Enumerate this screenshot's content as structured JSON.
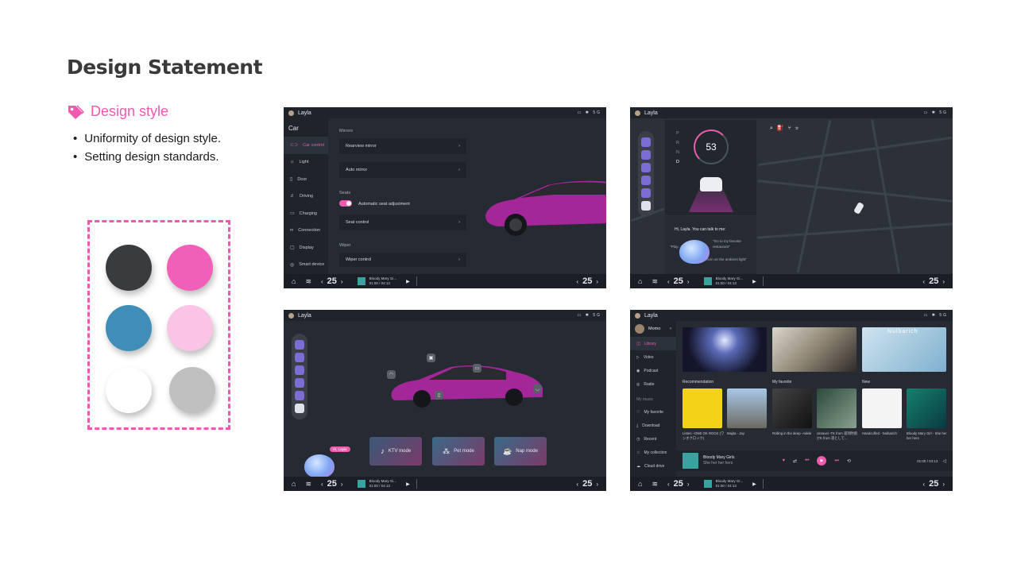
{
  "heading": "Design Statement",
  "style_section": {
    "label": "Design style",
    "bullets": [
      "Uniformity of design style.",
      "Setting design standards."
    ]
  },
  "palette": [
    "#3a3b3d",
    "#f060b8",
    "#3f8db8",
    "#fbc4e6",
    "#ffffff",
    "#c0c0c0"
  ],
  "common": {
    "user_name": "Layla",
    "status": "▭ ✱ 5G",
    "temp_left": "25",
    "temp_right": "25",
    "song_title": "Bloody Mary Gi...",
    "song_time": "01:00 / 04:13"
  },
  "screen1": {
    "sidebar_title": "Car",
    "sidebar_items": [
      "Car control",
      "Light",
      "Door",
      "Driving",
      "Charging",
      "Connection",
      "Display",
      "Smart device"
    ],
    "sections": {
      "mirrors": "Mirrors",
      "seats": "Seats",
      "wiper": "Wiper"
    },
    "rows": {
      "rearview": "Rearview mirror",
      "auto_mirror": "Auto mirror",
      "auto_seat": "Automatic seat adjustment",
      "seat_control": "Seat control",
      "wiper_control": "Wiper control"
    }
  },
  "screen2": {
    "speed": "53",
    "gears": [
      "P",
      "R",
      "N",
      "D"
    ],
    "greeting": "Hi, Layla. You can talk to me:",
    "suggestions": [
      "\"Go to my favorite restaurant\"",
      "\"Play...\"",
      "\"Turn on the ambient light\""
    ]
  },
  "screen3": {
    "modes": [
      "KTV mode",
      "Pet mode",
      "Nap mode"
    ],
    "greeting_pill": "Hi, Layla"
  },
  "screen4": {
    "user": "Momo",
    "sidebar_items": [
      "Library",
      "Video",
      "Podcast",
      "Radio"
    ],
    "my_music_label": "My music",
    "my_music_items": [
      "My favorite",
      "Download",
      "Recent",
      "My collection",
      "Cloud drive"
    ],
    "section_labels": {
      "recommendation": "Recommendation",
      "favorite": "My favorite",
      "new": "New"
    },
    "albums": [
      {
        "caption": "Listen –ONE OK ROCK (ワンオクロック)"
      },
      {
        "caption": "Majita - Jay"
      },
      {
        "caption": "Rolling in the deep -Adele"
      },
      {
        "caption": "Unravel -TK from 凛冽时雨 (TK from 凛として..."
      },
      {
        "caption": "Handcuffed - Nulbarich"
      },
      {
        "caption": "Bloody Mary Girl - She her her hers"
      }
    ],
    "banner_text": "Nulbarich",
    "player": {
      "title": "Bloody Mary Girls",
      "artist": "She her her hers",
      "time": "01:00 / 04:13"
    }
  }
}
